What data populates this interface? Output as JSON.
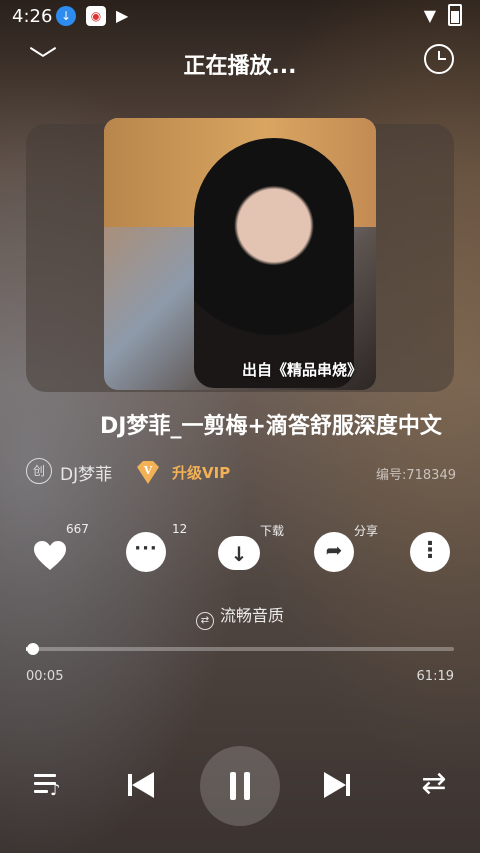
{
  "status_bar": {
    "time": "4:26",
    "icons": [
      "download-icon",
      "app-badge-icon",
      "play-icon",
      "wifi-icon",
      "battery-icon"
    ]
  },
  "header": {
    "title": "正在播放...",
    "back_icon": "chevron-down-icon",
    "alarm_icon": "alarm-clock-icon"
  },
  "cover": {
    "caption": "出自《精品串烧》"
  },
  "song": {
    "title": "DJ梦菲_一剪梅+滴答舒服深度中文",
    "artist": "DJ梦菲",
    "create_badge": "创",
    "vip_label": "升级VIP",
    "vip_badge": "V",
    "number": "编号:718349"
  },
  "actions": {
    "like_count": "667",
    "comment_count": "12",
    "download_label": "下载",
    "share_label": "分享"
  },
  "quality": {
    "label": "流畅音质",
    "icon": "⇄"
  },
  "playback": {
    "current_time": "00:05",
    "total_time": "61:19",
    "progress_fraction": 0.0014,
    "state": "playing"
  },
  "colors": {
    "vip_accent": "#f3b156"
  }
}
